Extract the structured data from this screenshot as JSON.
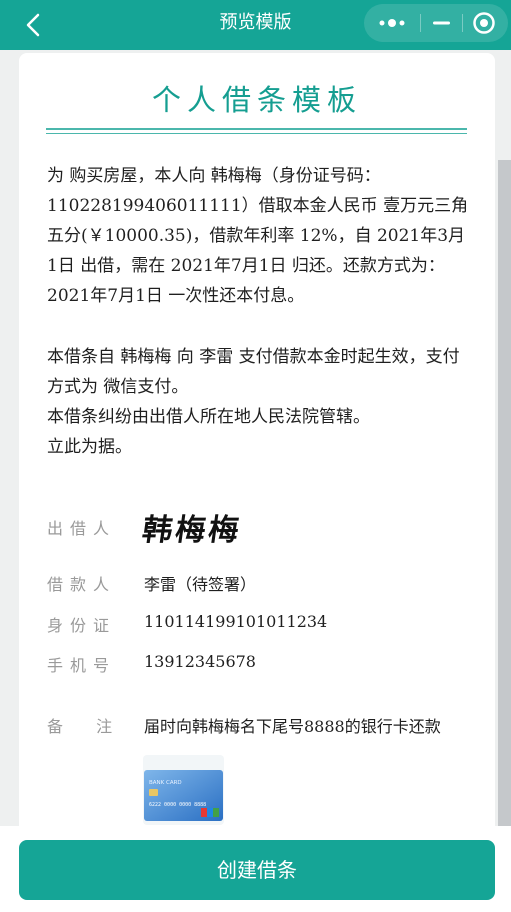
{
  "navbar": {
    "title": "预览模版",
    "back_icon": "chevron-left-icon",
    "more_icon": "more-dots-icon",
    "minimize_icon": "minimize-icon",
    "close_icon": "target-circle-icon"
  },
  "document": {
    "title": "个人借条模板",
    "paragraphs": [
      "为 购买房屋，本人向 韩梅梅（身份证号码：110228199406011111）借取本金人民币 壹万元三角五分(￥10000.35)，借款年利率 12%，自 2021年3月1日 出借，需在 2021年7月1日 归还。还款方式为： 2021年7月1日 一次性还本付息。",
      "本借条自 韩梅梅 向 李雷 支付借款本金时起生效，支付方式为 微信支付。",
      "本借条纠纷由出借人所在地人民法院管辖。",
      "立此为据。"
    ],
    "lender": {
      "label": "出借人",
      "signature": "韩梅梅"
    },
    "borrower": {
      "label": "借款人",
      "value": "李雷（待签署）"
    },
    "id_card": {
      "label": "身份证",
      "value": "110114199101011234"
    },
    "phone": {
      "label": "手机号",
      "value": "13912345678"
    },
    "remark": {
      "label": "备 注",
      "value": "届时向韩梅梅名下尾号8888的银行卡还款"
    },
    "bank_card_image": {
      "icon": "bank-card-icon",
      "brand_text": "BANK CARD",
      "number_text": "6222 0000 0000 8888"
    }
  },
  "footer": {
    "create_button": "创建借条"
  },
  "colors": {
    "primary": "#15a596",
    "title_text": "#159e91",
    "label_gray": "#9a9a9a",
    "page_bg": "#eef0f0"
  }
}
